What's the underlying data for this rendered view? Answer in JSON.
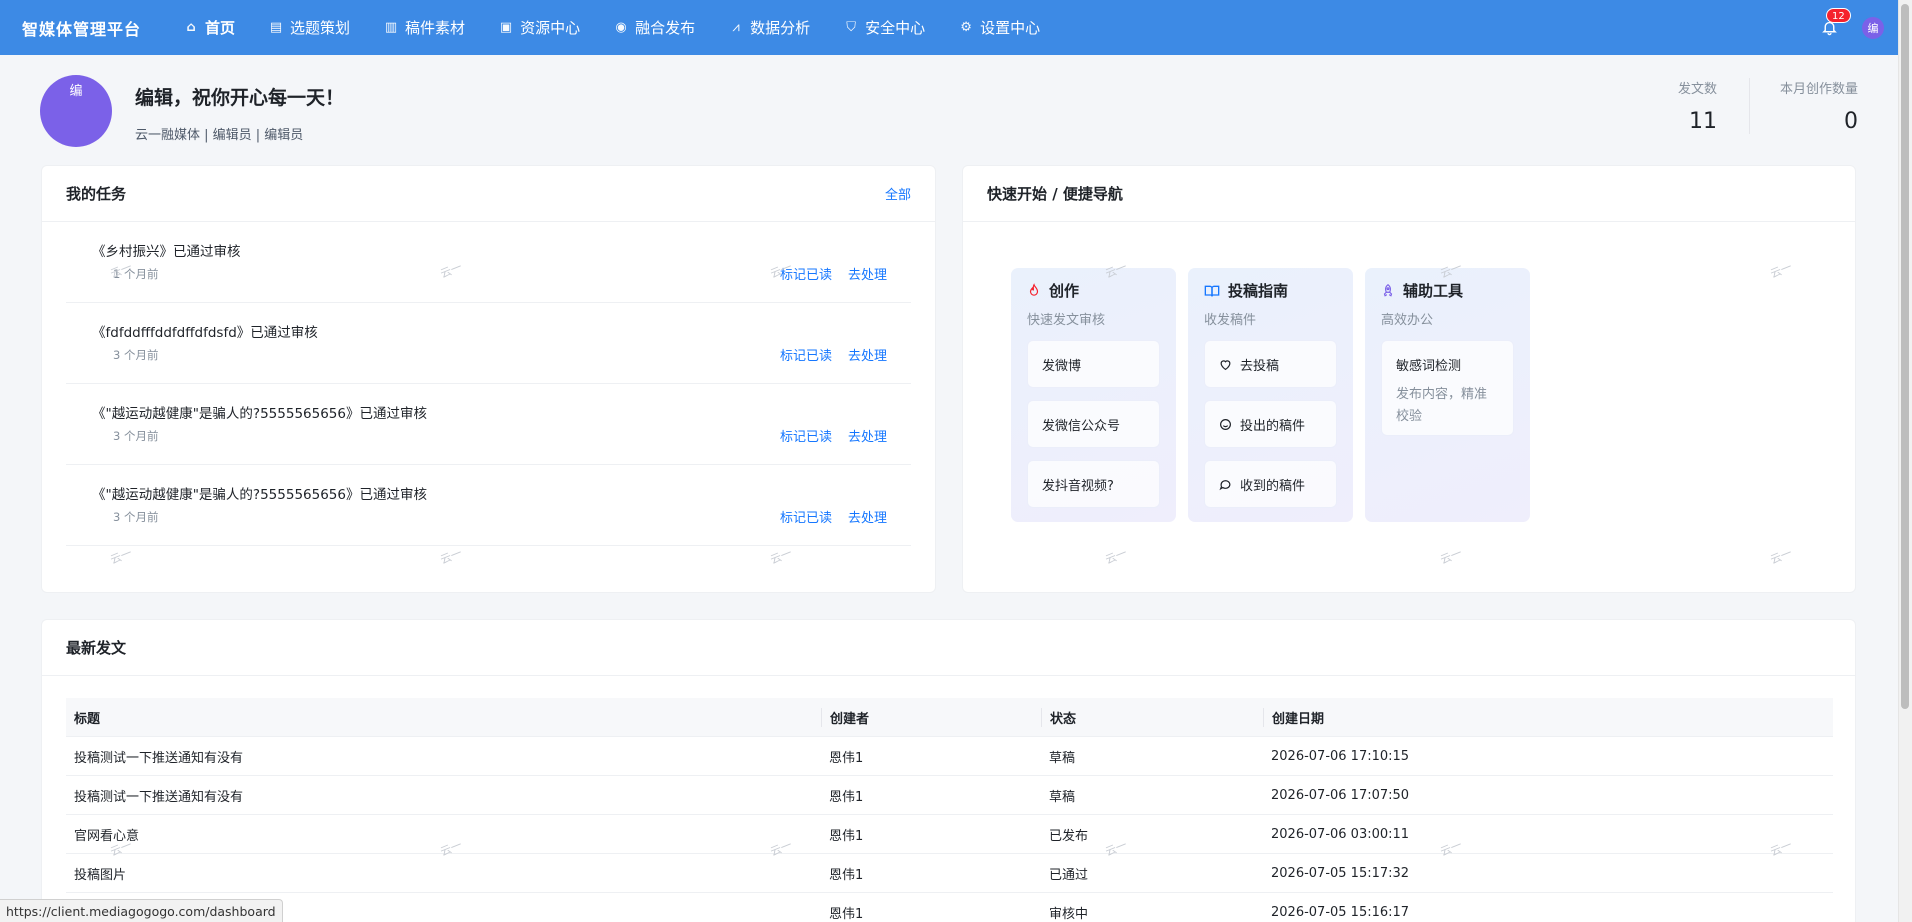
{
  "brand": "智媒体管理平台",
  "nav": [
    {
      "icon": "⌂",
      "icon_name": "home-icon",
      "label": "首页",
      "active": true
    },
    {
      "icon": "▤",
      "icon_name": "file-icon",
      "label": "选题策划"
    },
    {
      "icon": "▥",
      "icon_name": "document-icon",
      "label": "稿件素材"
    },
    {
      "icon": "▣",
      "icon_name": "picture-icon",
      "label": "资源中心"
    },
    {
      "icon": "◉",
      "icon_name": "location-icon",
      "label": "融合发布"
    },
    {
      "icon": "⩘",
      "icon_name": "chart-icon",
      "label": "数据分析"
    },
    {
      "icon": "⛉",
      "icon_name": "shield-icon",
      "label": "安全中心"
    },
    {
      "icon": "⚙",
      "icon_name": "gear-icon",
      "label": "设置中心"
    }
  ],
  "notifications": {
    "count": "12"
  },
  "user": {
    "avatar_char": "编",
    "greeting": "编辑，祝你开心每一天！",
    "subtitle": "云一融媒体 | 编辑员 | 编辑员"
  },
  "stats": [
    {
      "label": "发文数",
      "value": "11"
    },
    {
      "label": "本月创作数量",
      "value": "0"
    }
  ],
  "tasks": {
    "title": "我的任务",
    "all_label": "全部",
    "mark_read_label": "标记已读",
    "handle_label": "去处理",
    "items": [
      {
        "title": "《乡村振兴》已通过审核",
        "time": "1 个月前"
      },
      {
        "title": "《fdfddfffddfdffdfdsfd》已通过审核",
        "time": "3 个月前"
      },
      {
        "title": "《\"越运动越健康\"是骗人的?5555565656》已通过审核",
        "time": "3 个月前"
      },
      {
        "title": "《\"越运动越健康\"是骗人的?5555565656》已通过审核",
        "time": "3 个月前"
      }
    ]
  },
  "quick": {
    "title": "快速开始 / 便捷导航",
    "create": {
      "title": "创作",
      "icon_name": "flame-icon",
      "subtitle": "快速发文审核",
      "items": [
        "发微博",
        "发微信公众号",
        "发抖音视频?"
      ]
    },
    "guide": {
      "title": "投稿指南",
      "icon_name": "book-icon",
      "subtitle": "收发稿件",
      "items": [
        {
          "label": "去投稿",
          "icon_name": "heart-icon"
        },
        {
          "label": "投出的稿件",
          "icon_name": "smile-icon"
        },
        {
          "label": "收到的稿件",
          "icon_name": "chat-icon"
        }
      ]
    },
    "tools": {
      "title": "辅助工具",
      "icon_name": "rocket-icon",
      "subtitle": "高效办公",
      "tool_title": "敏感词检测",
      "tool_desc": "发布内容，精准校验"
    }
  },
  "latest": {
    "title": "最新发文",
    "columns": [
      "标题",
      "创建者",
      "状态",
      "创建日期"
    ],
    "rows": [
      [
        "投稿测试一下推送通知有没有",
        "恩伟1",
        "草稿",
        "2026-07-06 17:10:15"
      ],
      [
        "投稿测试一下推送通知有没有",
        "恩伟1",
        "草稿",
        "2026-07-06 17:07:50"
      ],
      [
        "官网看心意",
        "恩伟1",
        "已发布",
        "2026-07-06 03:00:11"
      ],
      [
        "投稿图片",
        "恩伟1",
        "已通过",
        "2026-07-05 15:17:32"
      ],
      [
        "",
        "恩伟1",
        "审核中",
        "2026-07-05 15:16:17"
      ]
    ]
  },
  "watermark": "云一",
  "status_url": "https://client.mediagogogo.com/dashboard"
}
